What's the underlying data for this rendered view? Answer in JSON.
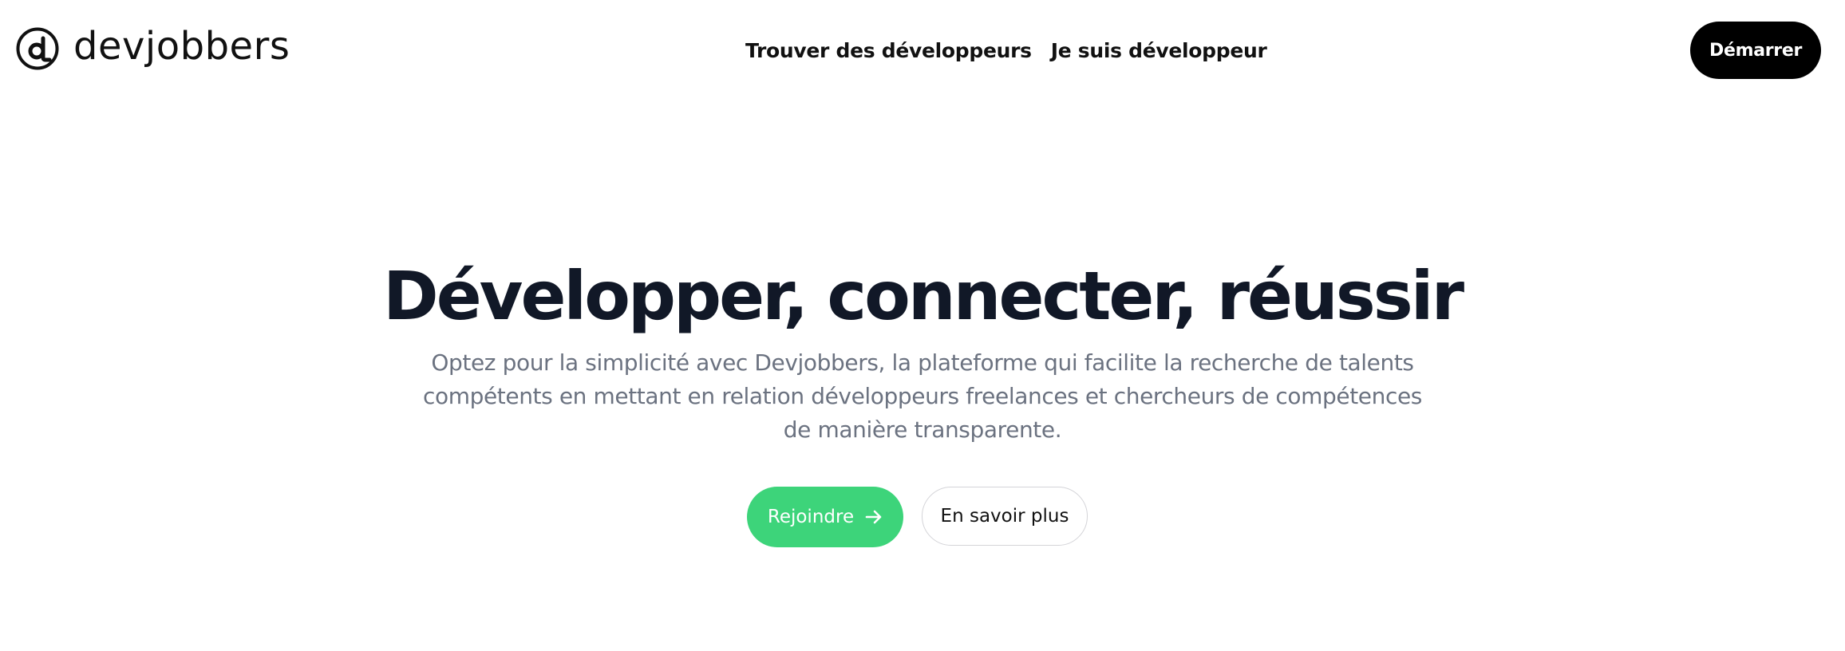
{
  "header": {
    "logo_text": "devjobbers",
    "logo_icon": "at-sign-d-icon",
    "nav": {
      "find_developers": "Trouver des développeurs",
      "i_am_developer": "Je suis développeur"
    },
    "cta_label": "Démarrer"
  },
  "hero": {
    "title": "Développer, connecter, réussir",
    "subtitle": "Optez pour la simplicité avec Devjobbers, la plateforme qui facilite la recherche de talents compétents en mettant en relation développeurs freelances et chercheurs de compétences de manière transparente.",
    "primary_button": "Rejoindre",
    "primary_button_icon": "arrow-right-icon",
    "secondary_button": "En savoir plus"
  },
  "colors": {
    "accent_green": "#3dd47a",
    "heading": "#111827",
    "body_text": "#6b7280",
    "cta_black": "#000000"
  }
}
